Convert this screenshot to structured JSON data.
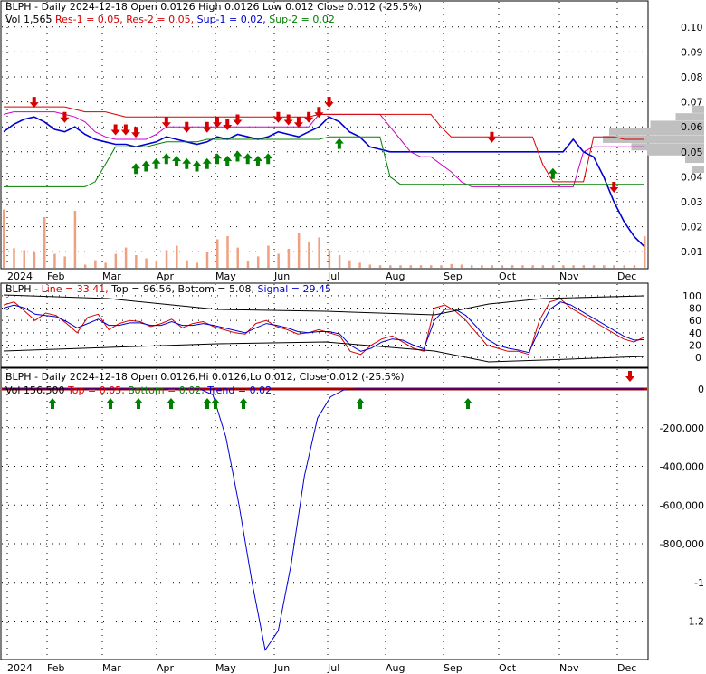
{
  "chart_data": [
    {
      "type": "line",
      "panel": "price",
      "header": {
        "ticker": "BLPH",
        "info": "Daily 2024-12-18 Open 0.0126  High 0.0126  Low 0.012  Close 0.012 (-25.5%)",
        "vol": "Vol 1,565",
        "res1": "Res-1 = 0.05,",
        "res2": "Res-2 = 0.05,",
        "sup1": "Sup-1 = 0.02,",
        "sup2": "Sup-2 = 0.02"
      },
      "months": [
        "2024",
        "Feb",
        "Mar",
        "Apr",
        "May",
        "Jun",
        "Jul",
        "Aug",
        "Sep",
        "Oct",
        "Nov",
        "Dec"
      ],
      "yticks": [
        "0.10",
        "0.09",
        "0.08",
        "0.07",
        "0.06",
        "0.05",
        "0.04",
        "0.03",
        "0.02",
        "0.01"
      ],
      "ylim": [
        0.005,
        0.105
      ],
      "series": [
        {
          "values": [
            0.058,
            0.061,
            0.063,
            0.064,
            0.062,
            0.059,
            0.058,
            0.06,
            0.057,
            0.055,
            0.054,
            0.053,
            0.053,
            0.052,
            0.053,
            0.054,
            0.056,
            0.055,
            0.054,
            0.053,
            0.054,
            0.056,
            0.055,
            0.057,
            0.056,
            0.055,
            0.056,
            0.058,
            0.057,
            0.056,
            0.058,
            0.06,
            0.064,
            0.062,
            0.058,
            0.056,
            0.052,
            0.051,
            0.05,
            0.05,
            0.05,
            0.05,
            0.05,
            0.05,
            0.05,
            0.05,
            0.05,
            0.05,
            0.05,
            0.05,
            0.05,
            0.05,
            0.05,
            0.05,
            0.05,
            0.05,
            0.055,
            0.05,
            0.048,
            0.04,
            0.03,
            0.022,
            0.016,
            0.012
          ]
        },
        {
          "values": [
            0.065,
            0.066,
            0.066,
            0.066,
            0.066,
            0.066,
            0.065,
            0.064,
            0.062,
            0.058,
            0.056,
            0.055,
            0.055,
            0.055,
            0.055,
            0.057,
            0.06,
            0.06,
            0.06,
            0.06,
            0.06,
            0.06,
            0.06,
            0.06,
            0.06,
            0.06,
            0.06,
            0.06,
            0.06,
            0.06,
            0.06,
            0.065,
            0.065,
            0.065,
            0.065,
            0.065,
            0.065,
            0.065,
            0.06,
            0.055,
            0.05,
            0.048,
            0.048,
            0.045,
            0.042,
            0.038,
            0.036,
            0.036,
            0.036,
            0.036,
            0.036,
            0.036,
            0.036,
            0.036,
            0.036,
            0.036,
            0.036,
            0.05,
            0.052,
            0.052,
            0.052,
            0.052,
            0.052,
            0.052
          ]
        },
        {
          "values": [
            0.068,
            0.068,
            0.068,
            0.068,
            0.068,
            0.068,
            0.068,
            0.067,
            0.066,
            0.066,
            0.066,
            0.065,
            0.064,
            0.064,
            0.064,
            0.064,
            0.064,
            0.064,
            0.064,
            0.064,
            0.064,
            0.064,
            0.064,
            0.064,
            0.064,
            0.064,
            0.064,
            0.064,
            0.064,
            0.064,
            0.064,
            0.065,
            0.065,
            0.065,
            0.065,
            0.065,
            0.065,
            0.065,
            0.065,
            0.065,
            0.065,
            0.065,
            0.065,
            0.06,
            0.056,
            0.056,
            0.056,
            0.056,
            0.056,
            0.056,
            0.056,
            0.056,
            0.056,
            0.045,
            0.038,
            0.038,
            0.038,
            0.038,
            0.056,
            0.056,
            0.056,
            0.055,
            0.055,
            0.055
          ]
        },
        {
          "values": [
            0.036,
            0.036,
            0.036,
            0.036,
            0.036,
            0.036,
            0.036,
            0.036,
            0.036,
            0.038,
            0.045,
            0.052,
            0.052,
            0.052,
            0.052,
            0.053,
            0.054,
            0.054,
            0.054,
            0.054,
            0.055,
            0.055,
            0.055,
            0.055,
            0.055,
            0.055,
            0.055,
            0.055,
            0.055,
            0.055,
            0.055,
            0.055,
            0.056,
            0.056,
            0.056,
            0.056,
            0.056,
            0.056,
            0.04,
            0.037,
            0.037,
            0.037,
            0.037,
            0.037,
            0.037,
            0.037,
            0.037,
            0.037,
            0.037,
            0.037,
            0.037,
            0.037,
            0.037,
            0.037,
            0.037,
            0.037,
            0.037,
            0.037,
            0.037,
            0.037,
            0.037,
            0.037,
            0.037,
            0.037
          ]
        }
      ],
      "up_arrow_at": [
        13,
        14,
        15,
        16,
        17,
        18,
        19,
        20,
        21,
        22,
        23,
        24,
        25,
        26,
        33,
        54
      ],
      "down_arrow_at": [
        3,
        6,
        11,
        12,
        13,
        16,
        18,
        20,
        21,
        22,
        23,
        27,
        28,
        29,
        30,
        31,
        32,
        48,
        60
      ],
      "volume": [
        0.92,
        0.31,
        0.28,
        0.25,
        0.8,
        0.22,
        0.18,
        0.9,
        0.05,
        0.12,
        0.08,
        0.22,
        0.32,
        0.2,
        0.15,
        0.1,
        0.28,
        0.35,
        0.12,
        0.08,
        0.25,
        0.45,
        0.5,
        0.32,
        0.1,
        0.18,
        0.35,
        0.22,
        0.3,
        0.55,
        0.4,
        0.48,
        0.28,
        0.2,
        0.12,
        0.08,
        0.05,
        0.04,
        0.04,
        0.04,
        0.04,
        0.04,
        0.04,
        0.04,
        0.06,
        0.05,
        0.04,
        0.04,
        0.04,
        0.04,
        0.04,
        0.04,
        0.04,
        0.04,
        0.04,
        0.04,
        0.04,
        0.04,
        0.04,
        0.04,
        0.04,
        0.04,
        0.04,
        0.5
      ]
    },
    {
      "type": "line",
      "panel": "stochastic",
      "header": {
        "ticker": "BLPH",
        "line": "Line = 33.41,",
        "top": "Top = 96.56,",
        "bottom": "Bottom = 5.08,",
        "signal": "Signal = 29.45"
      },
      "yticks": [
        "100",
        "80",
        "60",
        "40",
        "20",
        "0"
      ],
      "ylim": [
        -10,
        110
      ],
      "series": [
        {
          "values": [
            85,
            90,
            75,
            60,
            72,
            68,
            55,
            40,
            65,
            70,
            45,
            55,
            60,
            58,
            50,
            55,
            62,
            48,
            55,
            58,
            50,
            45,
            40,
            38,
            55,
            60,
            50,
            45,
            38,
            40,
            45,
            40,
            35,
            10,
            5,
            20,
            30,
            35,
            25,
            15,
            10,
            80,
            85,
            75,
            60,
            40,
            20,
            15,
            10,
            10,
            5,
            60,
            90,
            95,
            80,
            70,
            60,
            50,
            40,
            30,
            25,
            33
          ]
        },
        {
          "values": [
            80,
            85,
            80,
            70,
            68,
            66,
            58,
            48,
            55,
            62,
            52,
            52,
            56,
            56,
            52,
            52,
            58,
            52,
            52,
            55,
            52,
            48,
            44,
            40,
            48,
            55,
            52,
            48,
            42,
            40,
            42,
            42,
            38,
            20,
            10,
            15,
            25,
            30,
            28,
            20,
            14,
            60,
            78,
            78,
            68,
            50,
            30,
            20,
            15,
            12,
            8,
            45,
            78,
            90,
            85,
            75,
            65,
            55,
            45,
            35,
            28,
            29
          ]
        }
      ]
    },
    {
      "type": "line",
      "panel": "oscillator",
      "header": {
        "ticker": "BLPH",
        "info": "Daily 2024-12-18 Open 0.0126,Hi 0.0126,Lo 0.012, Close 0.012 (-25.5%)",
        "vol": "Vol 156,500",
        "top": "Top = 0.05,",
        "bottom": "Bottom = 0.02,",
        "trend": "Trend = 0.02"
      },
      "yticks": [
        "0",
        "-200,000",
        "-400,000",
        "-600,000",
        "-800,000",
        "-1",
        "-1.2"
      ],
      "ylim": [
        -1380000,
        40000
      ],
      "series": [
        {
          "values": [
            0,
            0,
            0,
            0,
            0,
            0,
            0,
            0,
            0,
            0,
            0,
            0,
            0,
            0,
            0,
            0,
            -30000,
            -250000,
            -600000,
            -1000000,
            -1350000,
            -1250000,
            -900000,
            -450000,
            -150000,
            -40000,
            -5000,
            0,
            0,
            0,
            0,
            0,
            0,
            0,
            0,
            0,
            0,
            0,
            0,
            0,
            0,
            0,
            0,
            0,
            0,
            0,
            0,
            0,
            0,
            0
          ]
        }
      ]
    }
  ]
}
